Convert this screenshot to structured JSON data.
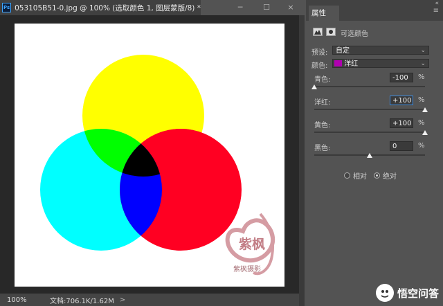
{
  "document": {
    "app_icon": "Ps",
    "tab_title": "053105B51-0.jpg @ 100% (选取颜色 1, 图层蒙版/8) *",
    "close_glyph": "×",
    "window_buttons": [
      "─",
      "☐",
      "×"
    ]
  },
  "status": {
    "zoom": "100%",
    "doc_info": "文档:706.1K/1.62M",
    "arrow": ">"
  },
  "canvas_art": {
    "seal_text": "紫枫",
    "signature_text": "紫枫摄影"
  },
  "panel": {
    "tab_label": "属性",
    "collapse_glyph": "«",
    "menu_glyph": "≡",
    "adjustment_title": "可选颜色",
    "preset_label": "预设:",
    "preset_value": "自定",
    "colors_label": "颜色:",
    "colors_value": "洋红",
    "colors_swatch": "#b000b0",
    "sliders": [
      {
        "label": "青色:",
        "value": "-100",
        "unit": "%",
        "level_pct": 0
      },
      {
        "label": "洋红:",
        "value": "+100",
        "unit": "%",
        "level_pct": 100
      },
      {
        "label": "黄色:",
        "value": "+100",
        "unit": "%",
        "level_pct": 100
      },
      {
        "label": "黑色:",
        "value": "0",
        "unit": "%",
        "level_pct": 50
      }
    ],
    "method_relative": "相对",
    "method_absolute": "绝对",
    "method_selected": "绝对"
  },
  "watermark": {
    "text": "悟空问答"
  }
}
